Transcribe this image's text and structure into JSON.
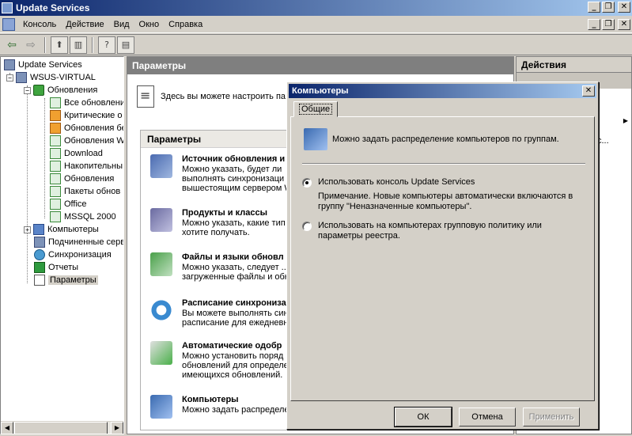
{
  "window": {
    "title": "Update Services"
  },
  "menu": [
    "Консоль",
    "Действие",
    "Вид",
    "Окно",
    "Справка"
  ],
  "tree": {
    "root": "Update Services",
    "server": "WSUS-VIRTUAL",
    "updates": "Обновления",
    "update_views": [
      "Все обновления",
      "Критические о",
      "Обновления бе",
      "Обновления W",
      "Download",
      "Накопительны",
      "Обновления",
      "Пакеты обнов",
      "Office",
      "MSSQL 2000"
    ],
    "computers": "Компьютеры",
    "downstream": "Подчиненные серв",
    "sync": "Синхронизация",
    "reports": "Отчеты",
    "options": "Параметры"
  },
  "middle": {
    "header": "Параметры",
    "intro": "Здесь вы можете настроить па",
    "params_header": "Параметры",
    "items": [
      {
        "title": "Источник обновления и",
        "desc": "Можно указать, будет ли\nвыполнять синхронизаци\nвышестоящим сервером W"
      },
      {
        "title": "Продукты и классы",
        "desc": "Можно указать, какие тип\nхотите получать."
      },
      {
        "title": "Файлы и языки обновл",
        "desc": "Можно указать, следует ..\nзагруженные файлы и обн"
      },
      {
        "title": "Расписание синхрониза",
        "desc": "Вы можете выполнять син\nрасписание для ежедневн"
      },
      {
        "title": "Автоматические одобр",
        "desc": "Можно установить поряд\nобновлений для определе\nимеющихся обновлений."
      },
      {
        "title": "Компьютеры",
        "desc": "Можно задать распределе"
      }
    ]
  },
  "actions": {
    "header": "Действия",
    "truncated": "с..."
  },
  "dialog": {
    "title": "Компьютеры",
    "tab": "Общие",
    "intro": "Можно задать распределение компьютеров по группам.",
    "option1": "Использовать консоль Update Services",
    "note": "Примечание. Новые компьютеры автоматически включаются в группу \"Неназначенные компьютеры\".",
    "option2": "Использовать на компьютерах групповую политику или параметры реестра.",
    "ok": "ОК",
    "cancel": "Отмена",
    "apply": "Применить"
  }
}
